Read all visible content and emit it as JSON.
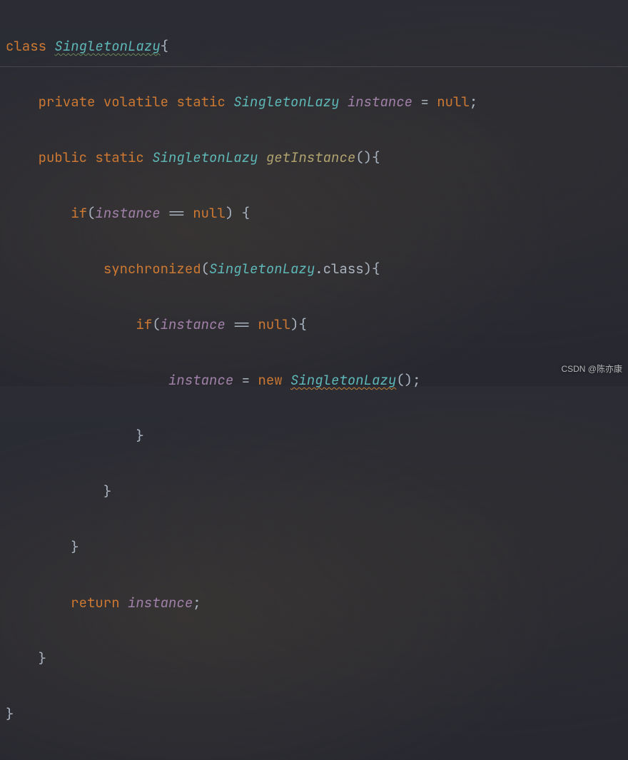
{
  "code": {
    "kw_class": "class",
    "cls_name": "SingletonLazy",
    "kw_private": "private",
    "kw_volatile": "volatile",
    "kw_static": "static",
    "type_name": "SingletonLazy",
    "field_name": "instance",
    "eq": "=",
    "null": "null",
    "semicolon": ";",
    "kw_public": "public",
    "method_name": "getInstance",
    "parens": "()",
    "lbrace": "{",
    "rbrace": "}",
    "kw_if": "if",
    "cond_open": "(",
    "cond_close": ")",
    "eq_eq": "==",
    "kw_sync": "synchronized",
    "dot_class": ".class",
    "kw_new": "new",
    "kw_return": "return"
  },
  "watermark": "CSDN @陈亦康"
}
